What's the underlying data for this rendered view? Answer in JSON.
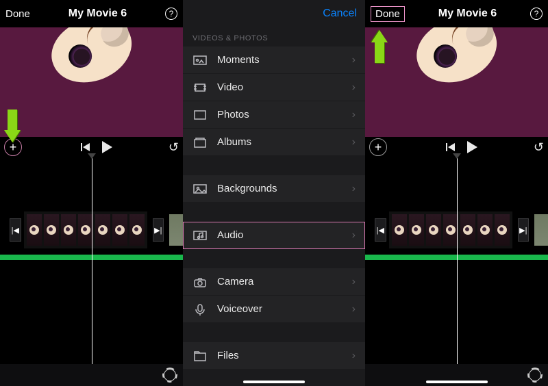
{
  "left": {
    "done": "Done",
    "title": "My Movie 6",
    "help": "?",
    "add": "+",
    "undo": "↺",
    "markers": [
      "|◀",
      "▶|"
    ]
  },
  "mid": {
    "cancel": "Cancel",
    "section": "VIDEOS & PHOTOS",
    "items": [
      {
        "label": "Moments",
        "icon": "moments"
      },
      {
        "label": "Video",
        "icon": "video"
      },
      {
        "label": "Photos",
        "icon": "photos"
      },
      {
        "label": "Albums",
        "icon": "albums"
      }
    ],
    "group2": [
      {
        "label": "Backgrounds",
        "icon": "image"
      }
    ],
    "group3": [
      {
        "label": "Audio",
        "icon": "audio",
        "highlight": true
      }
    ],
    "group4": [
      {
        "label": "Camera",
        "icon": "camera"
      },
      {
        "label": "Voiceover",
        "icon": "mic"
      }
    ],
    "group5": [
      {
        "label": "Files",
        "icon": "files"
      }
    ]
  },
  "right": {
    "done": "Done",
    "title": "My Movie 6",
    "help": "?",
    "add": "+",
    "undo": "↺"
  }
}
